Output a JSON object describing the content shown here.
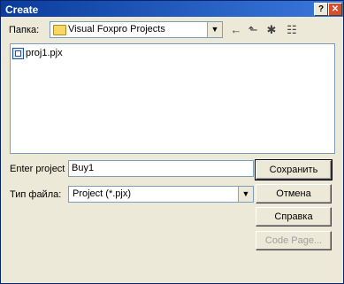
{
  "window": {
    "title": "Create",
    "help_glyph": "?",
    "close_glyph": "✕"
  },
  "location": {
    "label": "Папка:",
    "value": "Visual Foxpro Projects",
    "arrow": "▼"
  },
  "toolbar": {
    "back_glyph": "←",
    "up_glyph": "⬑",
    "new_folder_glyph": "✱",
    "view_glyph": "☷"
  },
  "files": [
    {
      "name": "proj1.pjx"
    }
  ],
  "project": {
    "label": "Enter project",
    "value": "Buy1"
  },
  "filetype": {
    "label": "Тип файла:",
    "value": "Project (*.pjx)",
    "arrow": "▼"
  },
  "buttons": {
    "save": "Сохранить",
    "cancel": "Отмена",
    "help": "Справка",
    "code_page": "Code Page..."
  }
}
